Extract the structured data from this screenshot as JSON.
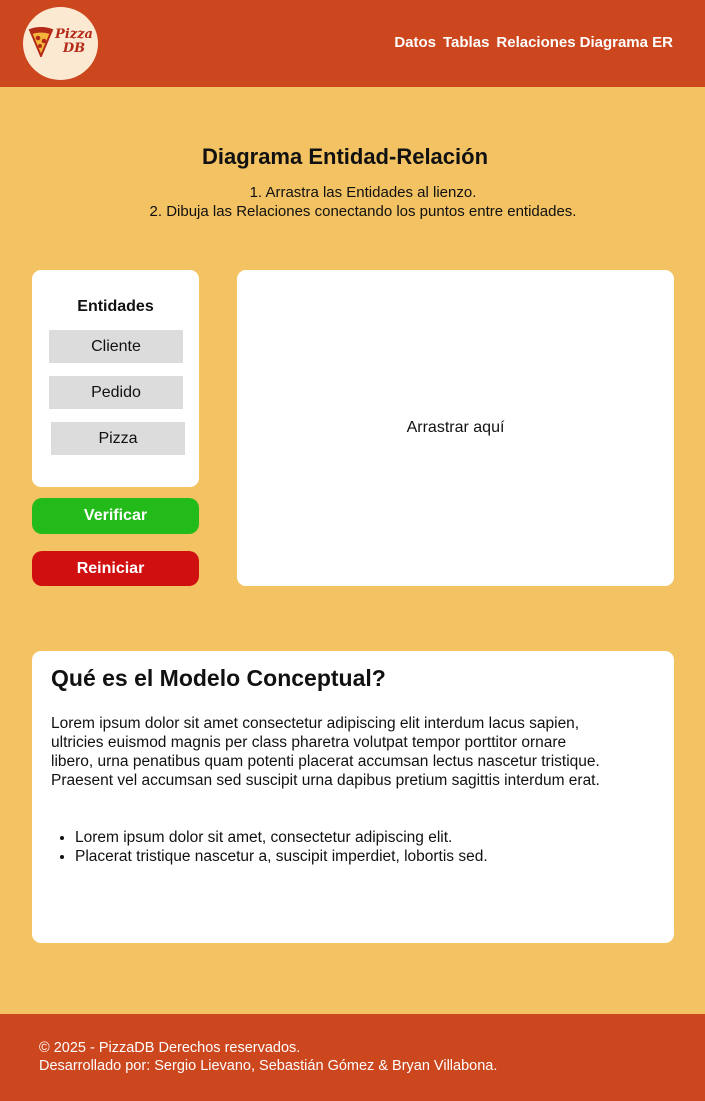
{
  "header": {
    "logo_text_line1": "Pizza",
    "logo_text_line2": "DB",
    "nav": [
      "Datos",
      "Tablas",
      "Relaciones",
      "Diagrama ER"
    ]
  },
  "main": {
    "title": "Diagrama Entidad-Relación",
    "instruction_1": "1. Arrastra las Entidades al lienzo.",
    "instruction_2": "2. Dibuja las Relaciones conectando los puntos entre entidades."
  },
  "entities_panel": {
    "title": "Entidades",
    "items": [
      "Cliente",
      "Pedido",
      "Pizza"
    ]
  },
  "buttons": {
    "verify": "Verificar",
    "reset": "Reiniciar"
  },
  "canvas": {
    "drop_label": "Arrastrar aquí"
  },
  "info_card": {
    "title": "Qué es el Modelo Conceptual?",
    "paragraph": "Lorem ipsum dolor sit amet consectetur adipiscing elit interdum lacus sapien, ultricies euismod magnis per class pharetra volutpat tempor porttitor ornare libero, urna penatibus quam potenti placerat accumsan lectus nascetur tristique. Praesent vel accumsan sed suscipit urna dapibus pretium sagittis interdum erat.",
    "bullets": [
      "Lorem ipsum dolor sit amet, consectetur adipiscing elit.",
      "Placerat tristique nascetur a, suscipit imperdiet, lobortis sed."
    ]
  },
  "footer": {
    "copyright": "© 2025 - PizzaDB Derechos reservados.",
    "credits": "Desarrollado por: Sergio Lievano, Sebastián Gómez & Bryan Villabona."
  },
  "colors": {
    "header_bg": "#cc461e",
    "page_bg": "#f3c262",
    "verify": "#22bb1a",
    "reset": "#d01010",
    "entity_bg": "#dcdcdc"
  }
}
